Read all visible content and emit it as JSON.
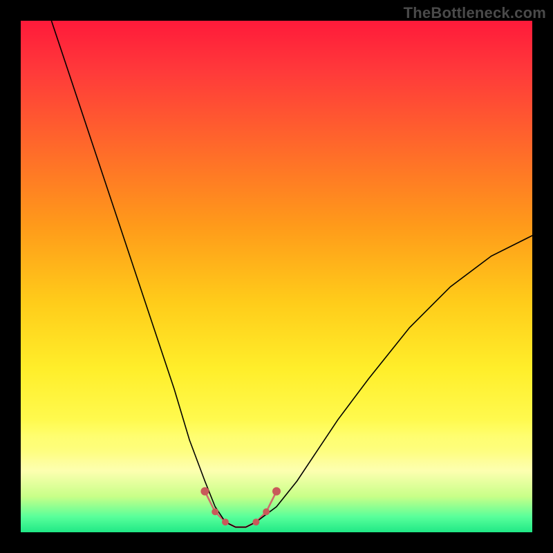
{
  "watermark": "TheBottleneck.com",
  "chart_data": {
    "type": "line",
    "title": "",
    "xlabel": "",
    "ylabel": "",
    "xlim": [
      0,
      100
    ],
    "ylim": [
      0,
      100
    ],
    "grid": false,
    "legend": false,
    "background_gradient": {
      "top": "#ff1a3a",
      "mid": "#ffee2a",
      "bottom": "#20e886",
      "meaning": "red = high bottleneck, green = low bottleneck"
    },
    "series": [
      {
        "name": "bottleneck-curve",
        "color": "#000000",
        "x": [
          6,
          10,
          14,
          18,
          22,
          26,
          30,
          33,
          36,
          38,
          40,
          42,
          44,
          46,
          50,
          54,
          58,
          62,
          68,
          76,
          84,
          92,
          100
        ],
        "values": [
          100,
          88,
          76,
          64,
          52,
          40,
          28,
          18,
          10,
          5,
          2,
          1,
          1,
          2,
          5,
          10,
          16,
          22,
          30,
          40,
          48,
          54,
          58
        ]
      },
      {
        "name": "optimal-region-highlight",
        "color": "#d46a6a",
        "x": [
          36,
          38,
          40,
          42,
          44,
          46,
          48,
          50
        ],
        "values": [
          8,
          4,
          2,
          1,
          1,
          2,
          4,
          8
        ]
      }
    ],
    "markers": [
      {
        "name": "left-edge-marker",
        "x": 36,
        "y": 8,
        "color": "#c85a5a",
        "r": 6
      },
      {
        "name": "left-mid-marker",
        "x": 38,
        "y": 4,
        "color": "#c85a5a",
        "r": 5
      },
      {
        "name": "min-region-start",
        "x": 40,
        "y": 2,
        "color": "#c85a5a",
        "r": 5
      },
      {
        "name": "min-region-end",
        "x": 46,
        "y": 2,
        "color": "#c85a5a",
        "r": 5
      },
      {
        "name": "right-mid-marker",
        "x": 48,
        "y": 4,
        "color": "#c85a5a",
        "r": 5
      },
      {
        "name": "right-edge-marker",
        "x": 50,
        "y": 8,
        "color": "#c85a5a",
        "r": 6
      }
    ]
  }
}
